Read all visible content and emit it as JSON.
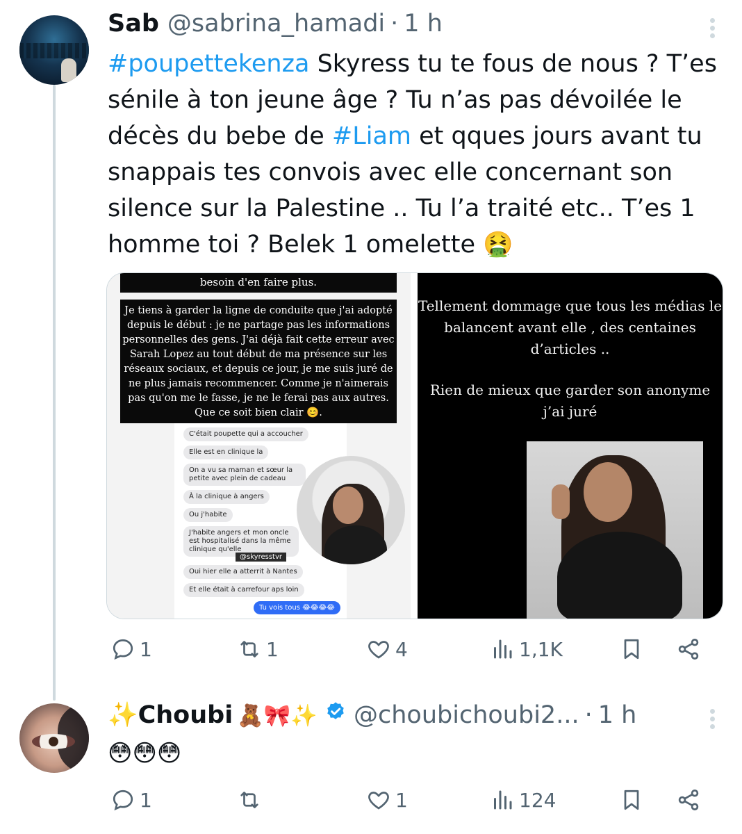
{
  "tweet": {
    "author_name": "Sab",
    "author_handle": "@sabrina_hamadi",
    "separator": "·",
    "time": "1 h",
    "text_parts": [
      {
        "type": "hashtag",
        "text": "#poupettekenza"
      },
      {
        "type": "text",
        "text": " Skyress tu te fous de nous ? T’es sénile à ton jeune âge ? Tu n’as pas dévoilée le décès du bebe de "
      },
      {
        "type": "hashtag",
        "text": "#Liam"
      },
      {
        "type": "text",
        "text": " et qques jours avant tu snappais tes convois avec elle concernant son silence sur la Palestine .. Tu l’a traité etc.. T’es 1 homme toi ? Belek 1 omelette 🤮"
      }
    ],
    "media": {
      "left": {
        "top_caption": "besoin d'en faire plus.",
        "statement": "Je tiens à garder la ligne de conduite que j'ai adopté depuis le début : je ne partage pas les informations personnelles des gens. J'ai déjà fait cette erreur avec Sarah Lopez au tout début de ma présence sur les réseaux sociaux, et depuis ce jour, je me suis juré de ne plus jamais recommencer. Comme je n'aimerais pas qu'on me le fasse, je ne le ferai pas aux autres. Que ce soit bien clair 😊.",
        "messages": [
          "C'était poupette qui a accoucher",
          "Elle est en clinique la",
          "On a vu sa maman et sœur la petite avec plein de cadeau",
          "À la clinique à angers",
          "Ou j'habite",
          "J'habite angers et mon oncle est hospitalisé dans la même clinique qu'elle",
          "Oui hier elle a atterrit à Nantes",
          "Et elle était à carrefour aps loin"
        ],
        "my_message": "Tu vois tous 😂😂😂😂",
        "sticker": "@skyresstvr"
      },
      "right": {
        "text1": "Tellement dommage que tous les médias le balancent avant elle , des centaines d’articles ..",
        "text2": "Rien de mieux que garder son anonyme j’ai juré"
      }
    },
    "actions": {
      "replies": "1",
      "retweets": "1",
      "likes": "4",
      "views": "1,1K"
    }
  },
  "reply": {
    "author_name": "✨Choubi",
    "author_emojis": "🧸🎀✨",
    "author_handle": "@choubichoubi2...",
    "separator": "·",
    "time": "1 h",
    "text": "😳😳😳",
    "actions": {
      "replies": "1",
      "retweets": "",
      "likes": "1",
      "views": "124"
    }
  },
  "colors": {
    "link": "#1d9bf0",
    "muted": "#536471",
    "line": "#cfd9de",
    "verified": "#1d9bf0"
  }
}
